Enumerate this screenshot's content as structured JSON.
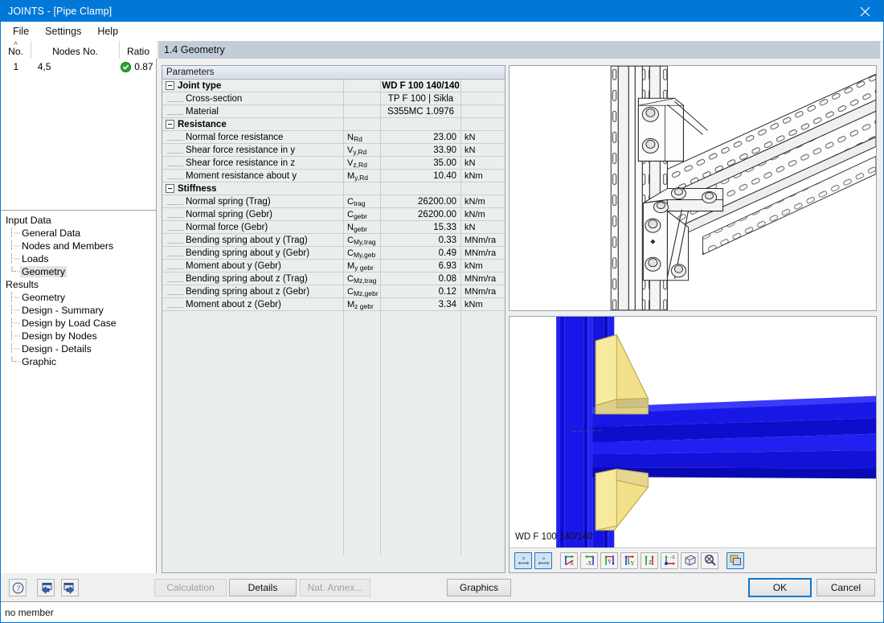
{
  "window": {
    "title": "JOINTS - [Pipe Clamp]",
    "close_icon": "close-icon"
  },
  "menu": {
    "items": [
      {
        "label": "File"
      },
      {
        "label": "Settings"
      },
      {
        "label": "Help"
      }
    ]
  },
  "joint_list": {
    "columns": [
      "No.",
      "Nodes No.",
      "Ratio"
    ],
    "sort_indicator": "˄",
    "rows": [
      {
        "no": "1",
        "nodes": "4,5",
        "ratio": "0.87",
        "status_icon": "check-circle-icon"
      }
    ]
  },
  "navigator": {
    "groups": [
      {
        "label": "Input Data",
        "items": [
          {
            "label": "General Data",
            "selected": false
          },
          {
            "label": "Nodes and Members",
            "selected": false
          },
          {
            "label": "Loads",
            "selected": false
          },
          {
            "label": "Geometry",
            "selected": true
          }
        ]
      },
      {
        "label": "Results",
        "items": [
          {
            "label": "Geometry",
            "selected": false
          },
          {
            "label": "Design - Summary",
            "selected": false
          },
          {
            "label": "Design by Load Case",
            "selected": false
          },
          {
            "label": "Design by Nodes",
            "selected": false
          },
          {
            "label": "Design - Details",
            "selected": false
          },
          {
            "label": "Graphic",
            "selected": false
          }
        ]
      }
    ]
  },
  "panel": {
    "header": "1.4 Geometry",
    "parameters_header": "Parameters"
  },
  "parameters": {
    "rows": [
      {
        "kind": "section",
        "desc": "Joint type",
        "sym": "",
        "val": "WD F 100 140/140",
        "unit": "",
        "text_value": true
      },
      {
        "kind": "leaf",
        "desc": "Cross-section",
        "sym": "",
        "val": "TP F 100 | Sikla",
        "unit": "",
        "text_value": true
      },
      {
        "kind": "leaf",
        "desc": "Material",
        "sym": "",
        "val": "S355MC 1.0976",
        "unit": "",
        "text_value": true
      },
      {
        "kind": "section",
        "desc": "Resistance",
        "sym": "",
        "val": "",
        "unit": ""
      },
      {
        "kind": "leaf",
        "desc": "Normal force resistance",
        "sym": "N",
        "sub": "Rd",
        "val": "23.00",
        "unit": "kN"
      },
      {
        "kind": "leaf",
        "desc": "Shear force resistance in y",
        "sym": "V",
        "sub": "y,Rd",
        "val": "33.90",
        "unit": "kN"
      },
      {
        "kind": "leaf",
        "desc": "Shear force resistance in z",
        "sym": "V",
        "sub": "z,Rd",
        "val": "35.00",
        "unit": "kN"
      },
      {
        "kind": "leaf",
        "desc": "Moment resistance about y",
        "sym": "M",
        "sub": "y,Rd",
        "val": "10.40",
        "unit": "kNm"
      },
      {
        "kind": "section",
        "desc": "Stiffness",
        "sym": "",
        "val": "",
        "unit": ""
      },
      {
        "kind": "leaf",
        "desc": "Normal spring (Trag)",
        "sym": "C",
        "sub": "trag",
        "val": "26200.00",
        "unit": "kN/m"
      },
      {
        "kind": "leaf",
        "desc": "Normal spring (Gebr)",
        "sym": "C",
        "sub": "gebr",
        "val": "26200.00",
        "unit": "kN/m"
      },
      {
        "kind": "leaf",
        "desc": "Normal force (Gebr)",
        "sym": "N",
        "sub": "gebr",
        "val": "15.33",
        "unit": "kN"
      },
      {
        "kind": "leaf",
        "desc": "Bending spring about y (Trag)",
        "sym": "C",
        "sub": "My,trag",
        "val": "0.33",
        "unit": "MNm/ra"
      },
      {
        "kind": "leaf",
        "desc": "Bending spring about y (Gebr)",
        "sym": "C",
        "sub": "My,geb",
        "val": "0.49",
        "unit": "MNm/ra"
      },
      {
        "kind": "leaf",
        "desc": "Moment about y (Gebr)",
        "sym": "M",
        "sub": "y gebr",
        "val": "6.93",
        "unit": "kNm"
      },
      {
        "kind": "leaf",
        "desc": "Bending spring about z (Trag)",
        "sym": "C",
        "sub": "Mz,trag",
        "val": "0.08",
        "unit": "MNm/ra"
      },
      {
        "kind": "leaf",
        "desc": "Bending spring about z (Gebr)",
        "sym": "C",
        "sub": "Mz,gebr",
        "val": "0.12",
        "unit": "MNm/ra"
      },
      {
        "kind": "leaf",
        "desc": "Moment about z (Gebr)",
        "sym": "M",
        "sub": "z gebr",
        "val": "3.34",
        "unit": "kNm"
      }
    ],
    "empty_rows": 19
  },
  "graphics": {
    "detail_drawing_name": "pipe-clamp-bracket-line-drawing",
    "model_label": "WD F 100 140/140",
    "toolbar": [
      {
        "name": "dimension-x-button",
        "label": "x",
        "active": true
      },
      {
        "name": "dimension-a-button",
        "label": "a",
        "active": true
      },
      {
        "name": "view-x-button",
        "label": "X",
        "active": false
      },
      {
        "name": "view-minus-x-button",
        "label": "-X",
        "active": false
      },
      {
        "name": "view-y-button",
        "label": "Y",
        "active": false
      },
      {
        "name": "view-minus-y-button",
        "label": "-Y",
        "active": false
      },
      {
        "name": "view-z-button",
        "label": "Z",
        "active": false
      },
      {
        "name": "view-minus-z-button",
        "label": "-Z",
        "active": false
      },
      {
        "name": "isometric-view-button",
        "label": "",
        "active": false
      },
      {
        "name": "zoom-all-button",
        "label": "",
        "active": false
      },
      {
        "name": "render-mode-button",
        "label": "",
        "active": true
      }
    ]
  },
  "bottom": {
    "help_icon": "help-icon",
    "prev_icon": "previous-arrow-icon",
    "next_icon": "next-arrow-icon",
    "calculation_label": "Calculation",
    "details_label": "Details",
    "nat_annex_label": "Nat. Annex...",
    "graphics_label": "Graphics",
    "ok_label": "OK",
    "cancel_label": "Cancel"
  },
  "status": {
    "text": "no member"
  },
  "colors": {
    "title_bar": "#0078d7",
    "panel_header": "#c3cdda",
    "accent_focus": "#0a78d4",
    "status_ok": "#2aa331",
    "model_steel": "#1a16e0",
    "model_plate": "#f2e08a"
  }
}
